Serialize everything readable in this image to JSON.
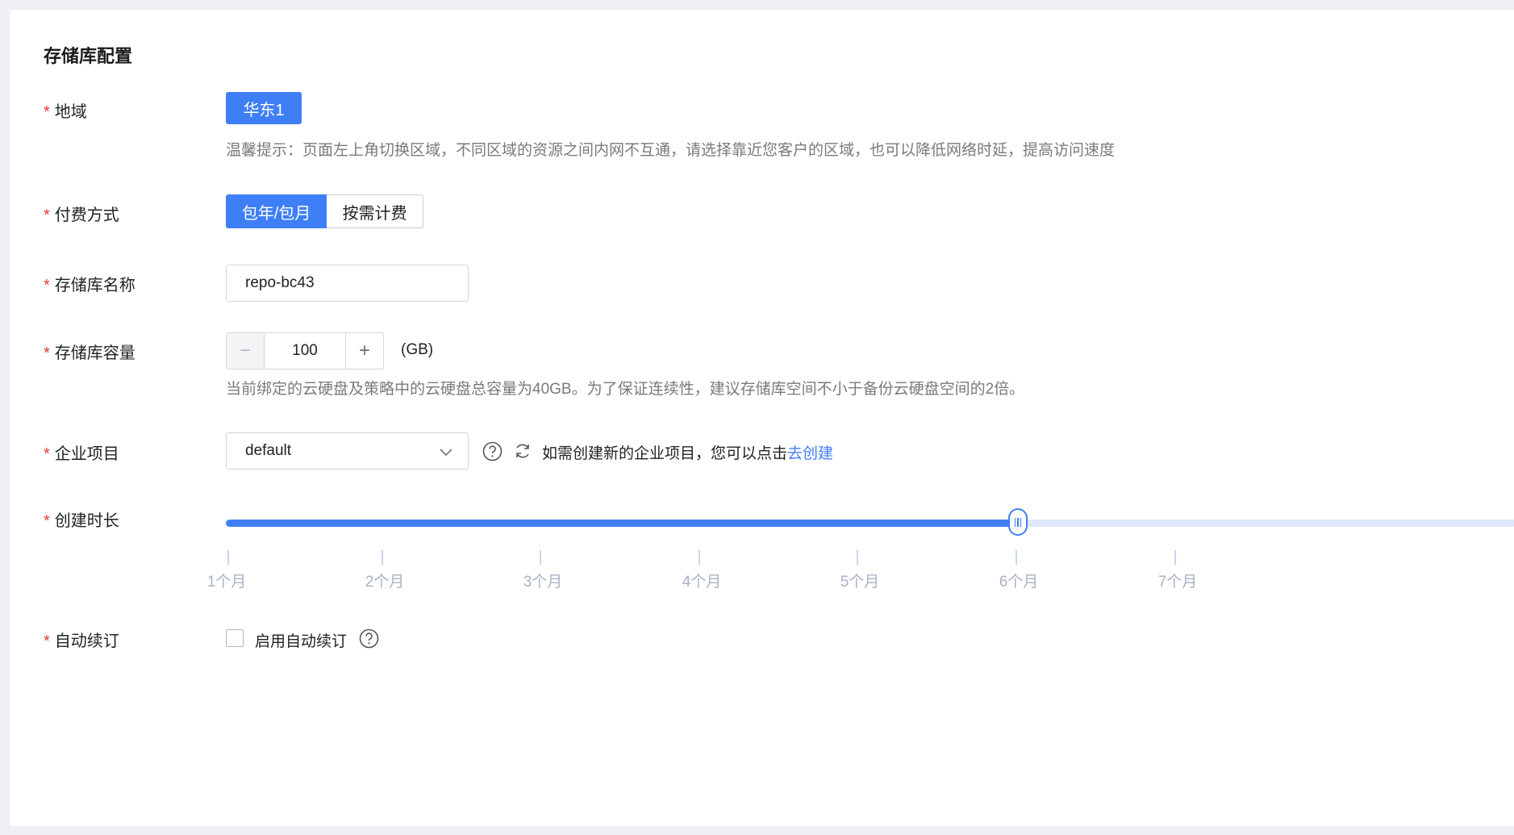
{
  "section_title": "存储库配置",
  "required_mark": "*",
  "region": {
    "label": "地域",
    "selected": "华东1",
    "hint": "温馨提示：页面左上角切换区域，不同区域的资源之间内网不互通，请选择靠近您客户的区域，也可以降低网络时延，提高访问速度"
  },
  "billing": {
    "label": "付费方式",
    "options": [
      "包年/包月",
      "按需计费"
    ],
    "selected_index": 0
  },
  "repo_name": {
    "label": "存储库名称",
    "value": "repo-bc43"
  },
  "capacity": {
    "label": "存储库容量",
    "minus": "−",
    "value": "100",
    "plus": "+",
    "unit": "(GB)",
    "hint": "当前绑定的云硬盘及策略中的云硬盘总容量为40GB。为了保证连续性，建议存储库空间不小于备份云硬盘空间的2倍。"
  },
  "project": {
    "label": "企业项目",
    "value": "default",
    "hint_prefix": "如需创建新的企业项目，您可以点击",
    "hint_link": "去创建"
  },
  "duration": {
    "label": "创建时长",
    "ticks": [
      "1个月",
      "2个月",
      "3个月",
      "4个月",
      "5个月",
      "6个月",
      "7个月"
    ],
    "selected": "6个月"
  },
  "auto_renew": {
    "label": "自动续订",
    "checkbox_label": "启用自动续订",
    "checked": false
  },
  "colors": {
    "primary": "#3e7ff5",
    "required": "#e5393b",
    "track": "#dfe8fb"
  }
}
